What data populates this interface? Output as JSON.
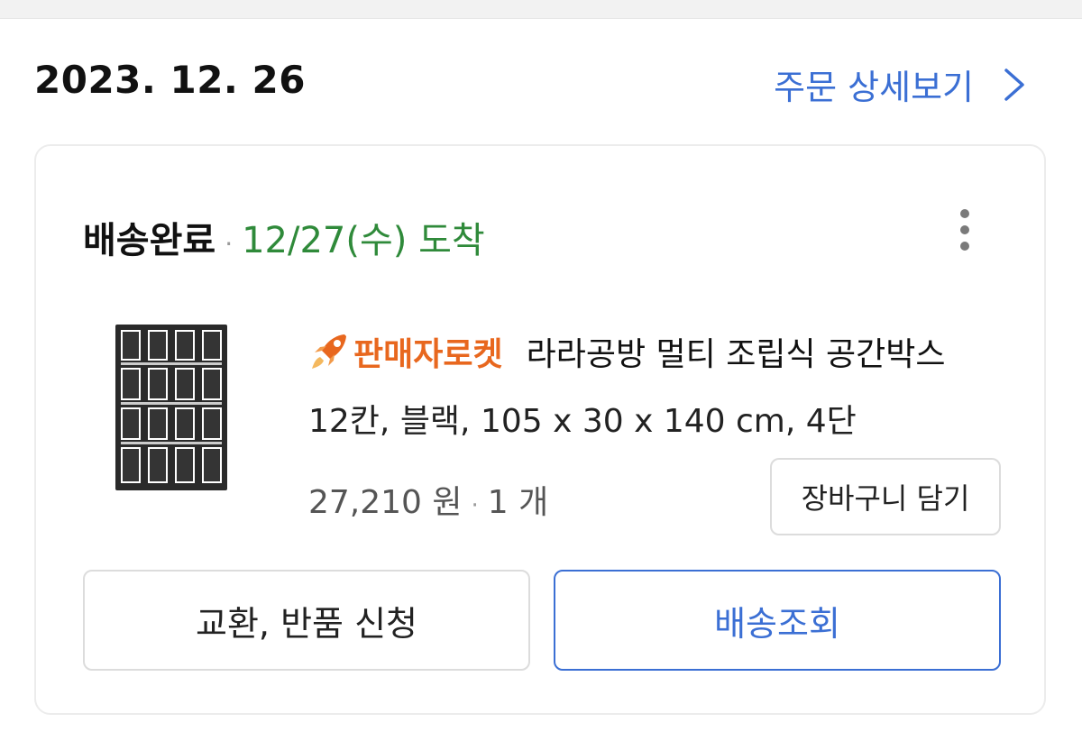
{
  "order": {
    "date": "2023. 12. 26",
    "detail_link_label": "주문 상세보기",
    "link_color": "#3b6fd4"
  },
  "delivery": {
    "status": "배송완료",
    "separator": "·",
    "arrival": "12/27(수) 도착",
    "arrival_color": "#2f8a3a"
  },
  "product": {
    "badge_label": "판매자로켓",
    "badge_color": "#e8671e",
    "badge_icon": "rocket-icon",
    "title_line1": "라라공방 멀티 조립식 공간박스",
    "title_line2": "12칸, 블랙, 105 x 30 x 140 cm, 4단",
    "price": "27,210 원",
    "quantity": "1 개",
    "image_icon": "shelf-product-image"
  },
  "buttons": {
    "add_to_cart": "장바구니 담기",
    "return_exchange": "교환, 반품 신청",
    "track_delivery": "배송조회"
  },
  "icons": {
    "detail_chevron": "chevron-right-icon",
    "more_menu": "more-vertical-icon"
  }
}
